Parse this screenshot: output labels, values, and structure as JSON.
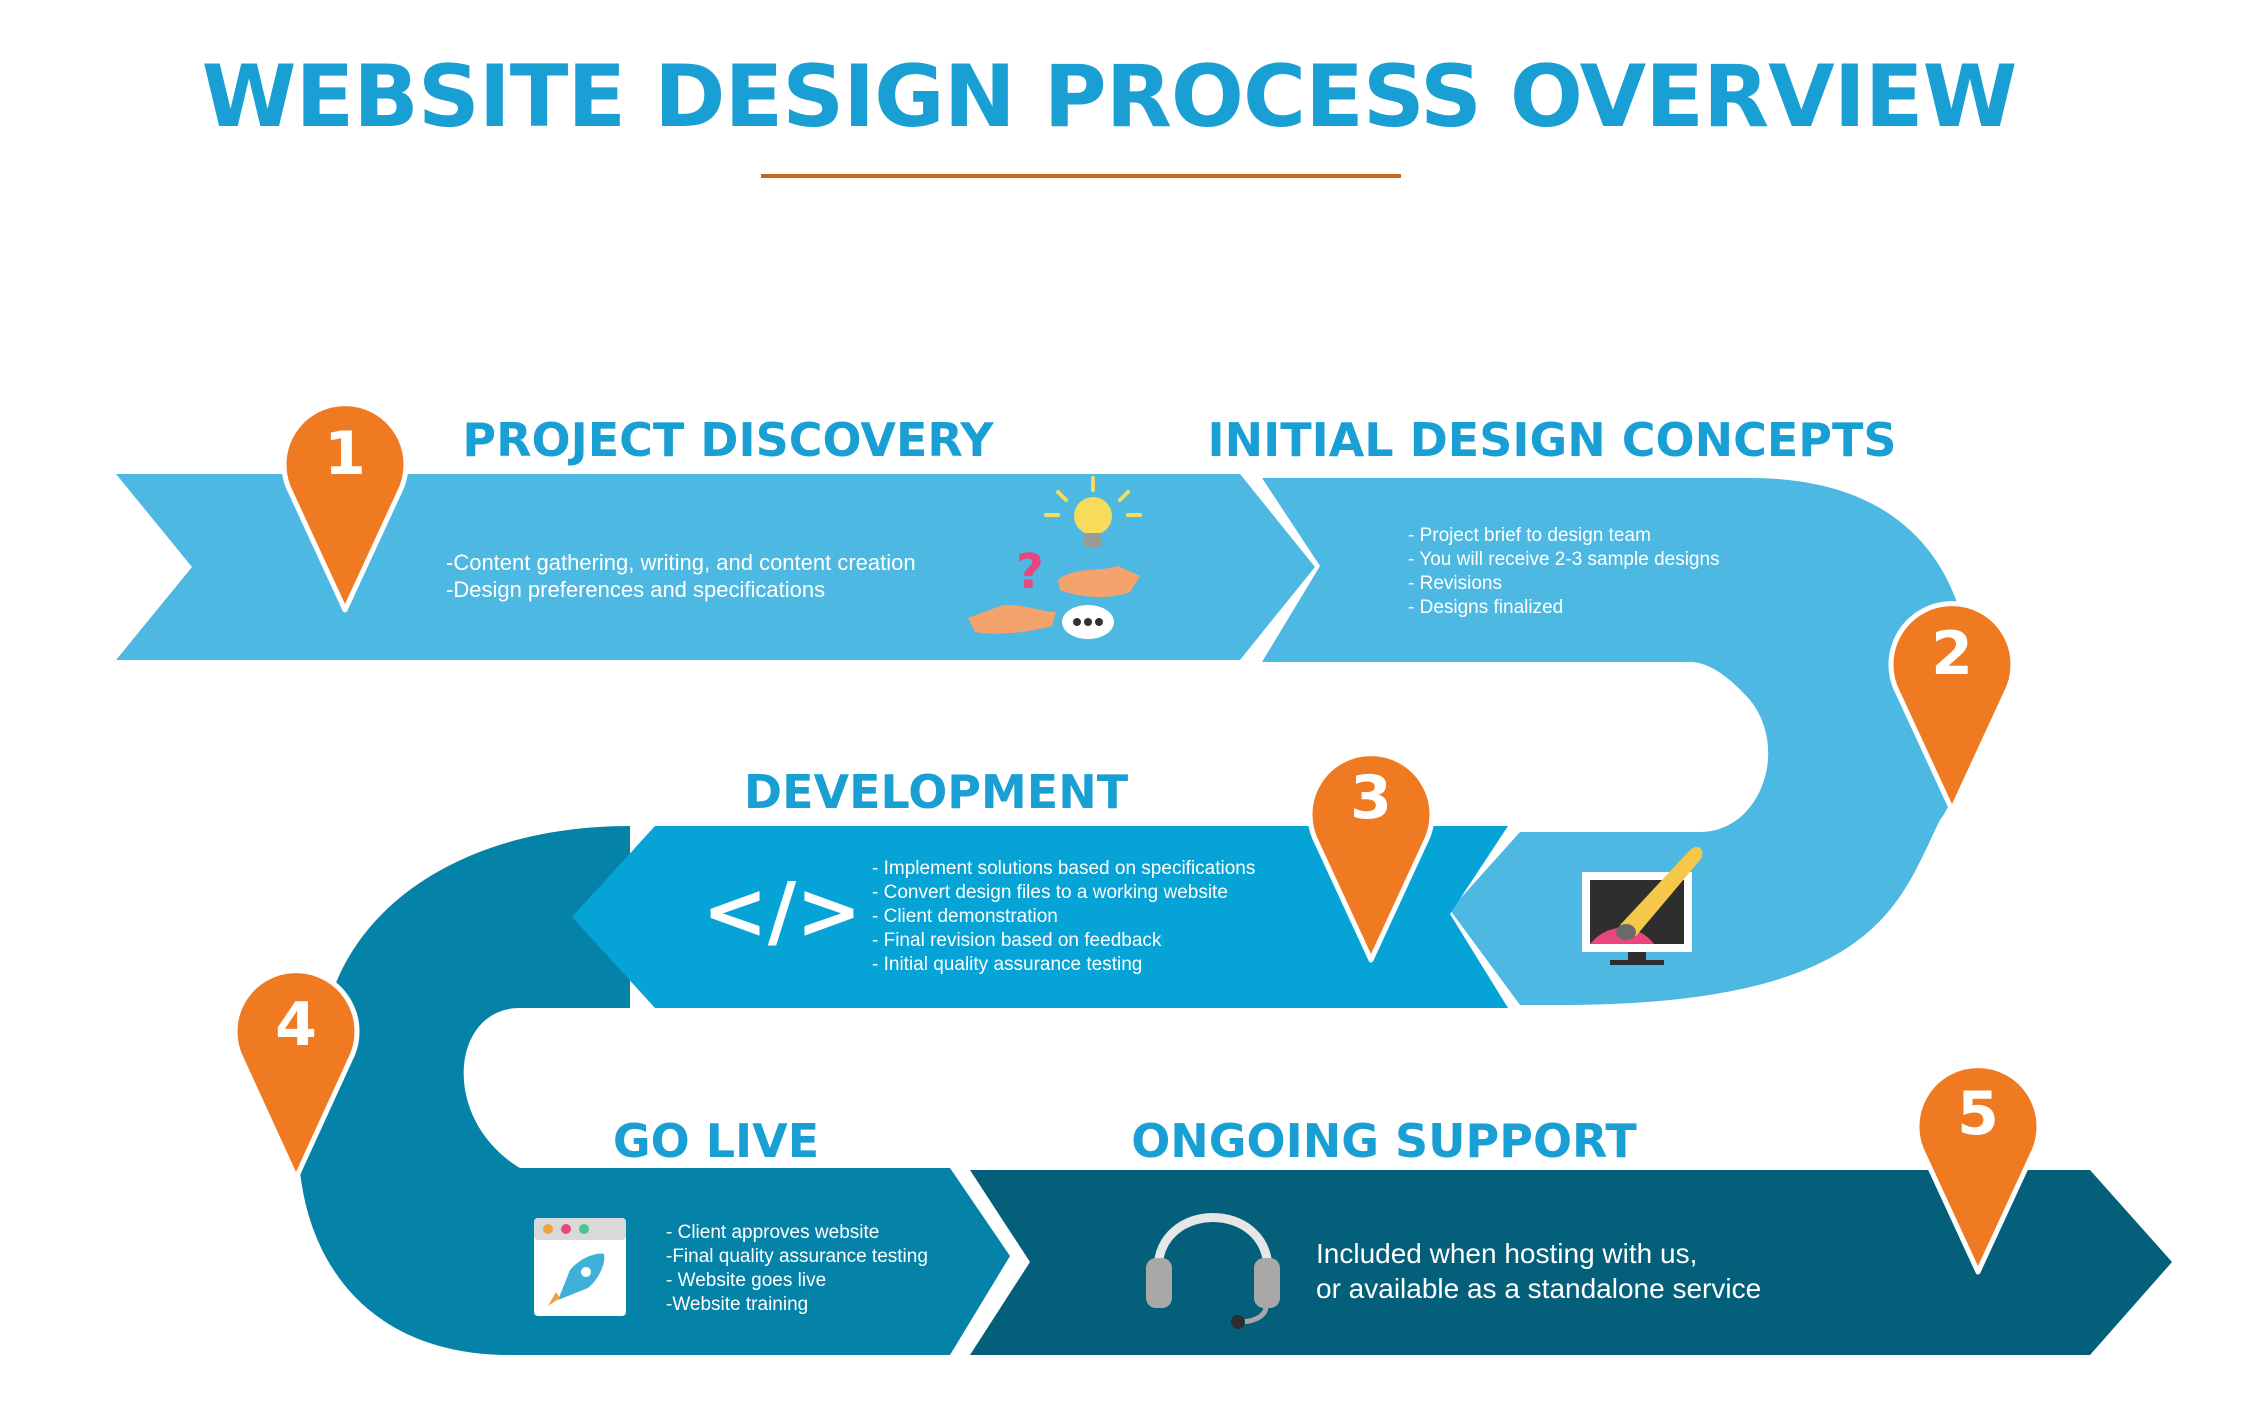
{
  "title": "WEBSITE DESIGN PROCESS OVERVIEW",
  "colors": {
    "title": "#1a9fd4",
    "rule": "#c8661a",
    "pin": "#f07a22",
    "band_light": "#4db8e2",
    "band_mid": "#06a3d6",
    "band_dark": "#0582a8",
    "band_darker": "#035f7a"
  },
  "steps": [
    {
      "number": "1",
      "title": "PROJECT DISCOVERY",
      "icon": "hands-idea-icon",
      "lines": [
        "-Content gathering, writing, and content creation",
        "-Design preferences and specifications"
      ]
    },
    {
      "number": "2",
      "title": "INITIAL DESIGN CONCEPTS",
      "icon": "monitor-paintbrush-icon",
      "lines": [
        "- Project brief to design team",
        "- You will receive 2-3 sample designs",
        "- Revisions",
        "- Designs finalized"
      ]
    },
    {
      "number": "3",
      "title": "DEVELOPMENT",
      "icon": "code-icon",
      "icon_text": "</>",
      "lines": [
        "- Implement solutions based on specifications",
        "- Convert design files to a working website",
        "- Client demonstration",
        "- Final revision based on feedback",
        "- Initial quality assurance testing"
      ]
    },
    {
      "number": "4",
      "title": "GO LIVE",
      "icon": "browser-rocket-icon",
      "lines": [
        "- Client approves website",
        "-Final quality assurance testing",
        "- Website goes live",
        "-Website training"
      ]
    },
    {
      "number": "5",
      "title": "ONGOING SUPPORT",
      "icon": "headset-icon",
      "lines": [
        "Included when hosting with us,",
        "or available as a standalone service"
      ]
    }
  ]
}
